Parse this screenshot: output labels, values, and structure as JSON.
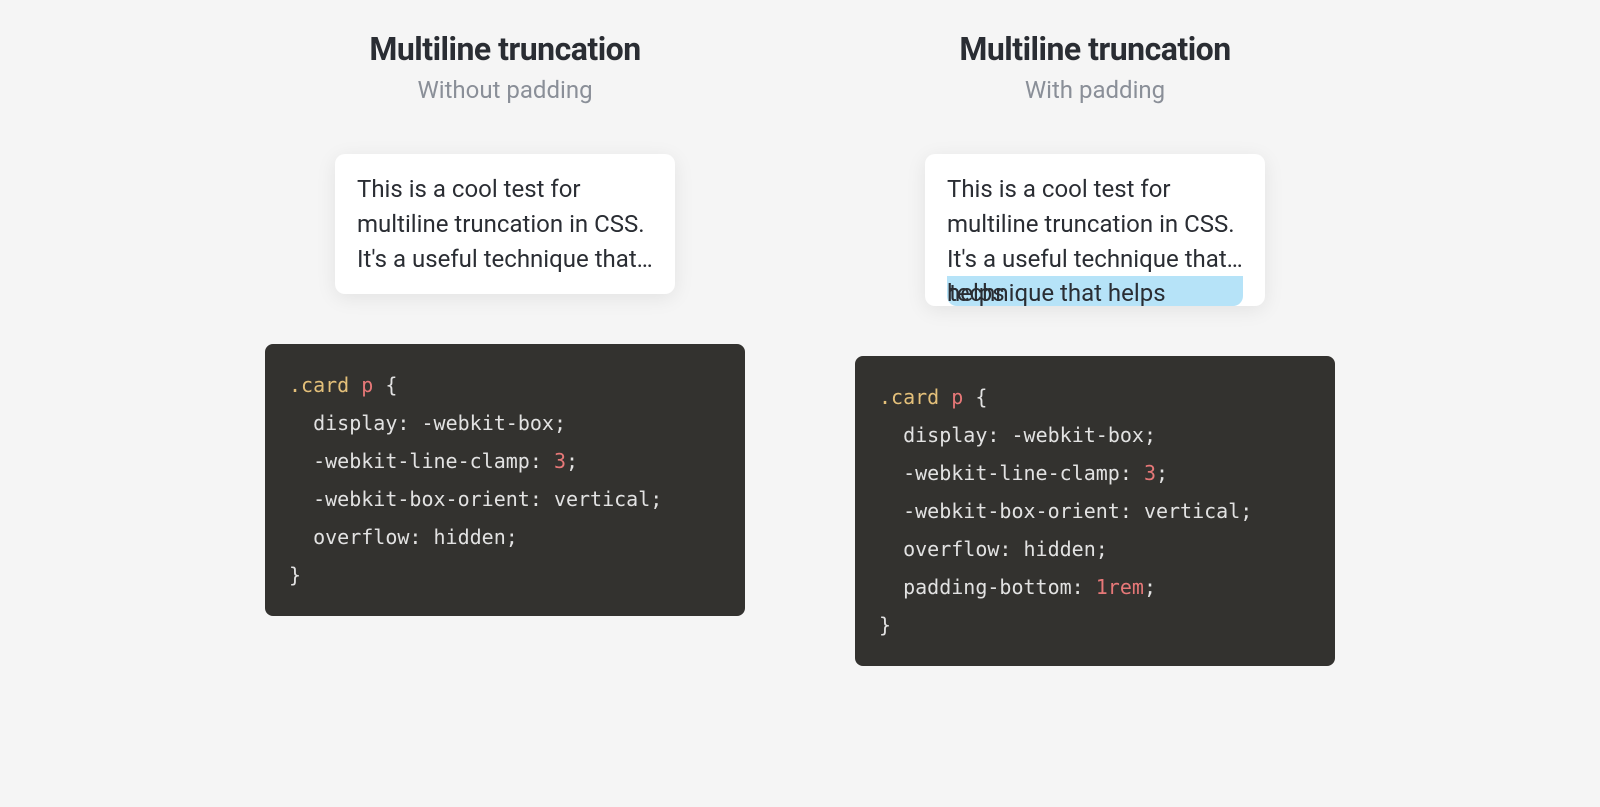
{
  "left": {
    "title": "Multiline truncation",
    "subtitle": "Without padding",
    "card_text": "This is a cool test for multiline truncation in CSS. It's a useful technique that helps",
    "code": {
      "selector_class": ".card",
      "selector_tag": "p",
      "brace_open": "{",
      "line1_prop": "display",
      "line1_val": "-webkit-box",
      "line2_prop": "-webkit-line-clamp",
      "line2_num": "3",
      "line3_prop": "-webkit-box-orient",
      "line3_val": "vertical",
      "line4_prop": "overflow",
      "line4_val": "hidden",
      "brace_close": "}"
    }
  },
  "right": {
    "title": "Multiline truncation",
    "subtitle": "With padding",
    "card_text": "This is a cool test for multiline truncation in CSS. It's a useful technique that helps",
    "overflow_text": "technique that helps",
    "code": {
      "selector_class": ".card",
      "selector_tag": "p",
      "brace_open": "{",
      "line1_prop": "display",
      "line1_val": "-webkit-box",
      "line2_prop": "-webkit-line-clamp",
      "line2_num": "3",
      "line3_prop": "-webkit-box-orient",
      "line3_val": "vertical",
      "line4_prop": "overflow",
      "line4_val": "hidden",
      "line5_prop": "padding-bottom",
      "line5_num": "1rem",
      "brace_close": "}"
    }
  }
}
